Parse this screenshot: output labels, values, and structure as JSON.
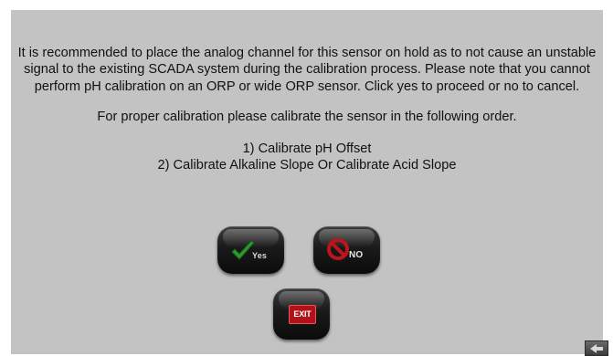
{
  "dialog": {
    "message": "It is recommended to place the analog channel for this sensor on hold as to not cause an unstable signal to the existing SCADA system during the calibration process. Please note that you cannot perform pH calibration on an ORP or wide ORP sensor. Click yes to proceed or no to cancel.",
    "order_intro": "For proper calibration please calibrate the sensor in the following order.",
    "steps": [
      "1) Calibrate pH Offset",
      "2) Calibrate Alkaline Slope Or Calibrate Acid Slope"
    ]
  },
  "buttons": {
    "yes_label": "Yes",
    "no_label": "NO",
    "exit_label": "EXIT"
  },
  "icons": {
    "yes": "checkmark-icon",
    "no": "no-entry-icon",
    "exit": "exit-sign-icon",
    "corner": "back-arrow-icon"
  },
  "colors": {
    "panel": "#c3c3c3",
    "check": "#2e9a2e",
    "no": "#c0141c",
    "exit": "#b0121a"
  }
}
